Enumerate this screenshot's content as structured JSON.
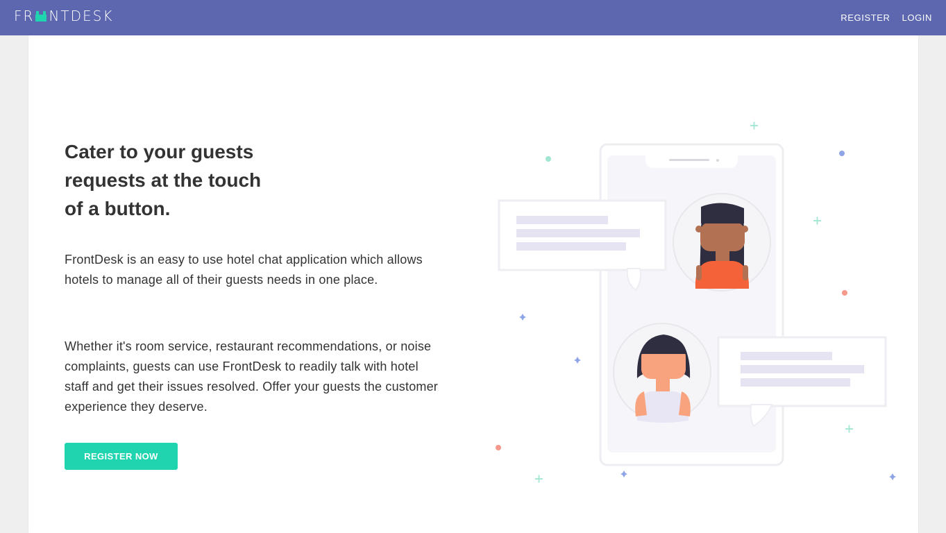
{
  "header": {
    "logo": {
      "prefix": "FR",
      "suffix": "NTDESK"
    },
    "nav": {
      "register_label": "REGISTER",
      "login_label": "LOGIN"
    }
  },
  "hero": {
    "headline_lines": [
      "Cater to your guests",
      "requests at the touch",
      "of a button."
    ],
    "paragraph_1": "FrontDesk is an easy to use hotel chat application which allows hotels to manage all of their guests needs in one place.",
    "paragraph_2": "Whether it's room service, restaurant recommendations, or noise complaints, guests can use FrontDesk to readily talk with hotel staff and get their issues resolved. Offer your guests the customer experience they deserve.",
    "cta_label": "REGISTER NOW"
  },
  "colors": {
    "navbar": "#5c67b0",
    "accent": "#1fd4ae",
    "text": "#333333",
    "bubble_line": "#e6e4f3",
    "staff_shirt": "#f4623a",
    "staff_skin": "#b17152",
    "guest_skin": "#f9a27e",
    "hair": "#2f2e41"
  },
  "illustration": {
    "name": "phone-chat-illustration",
    "icons": [
      "smartphone",
      "staff-avatar",
      "guest-avatar",
      "chat-bubble",
      "sparkle"
    ]
  }
}
